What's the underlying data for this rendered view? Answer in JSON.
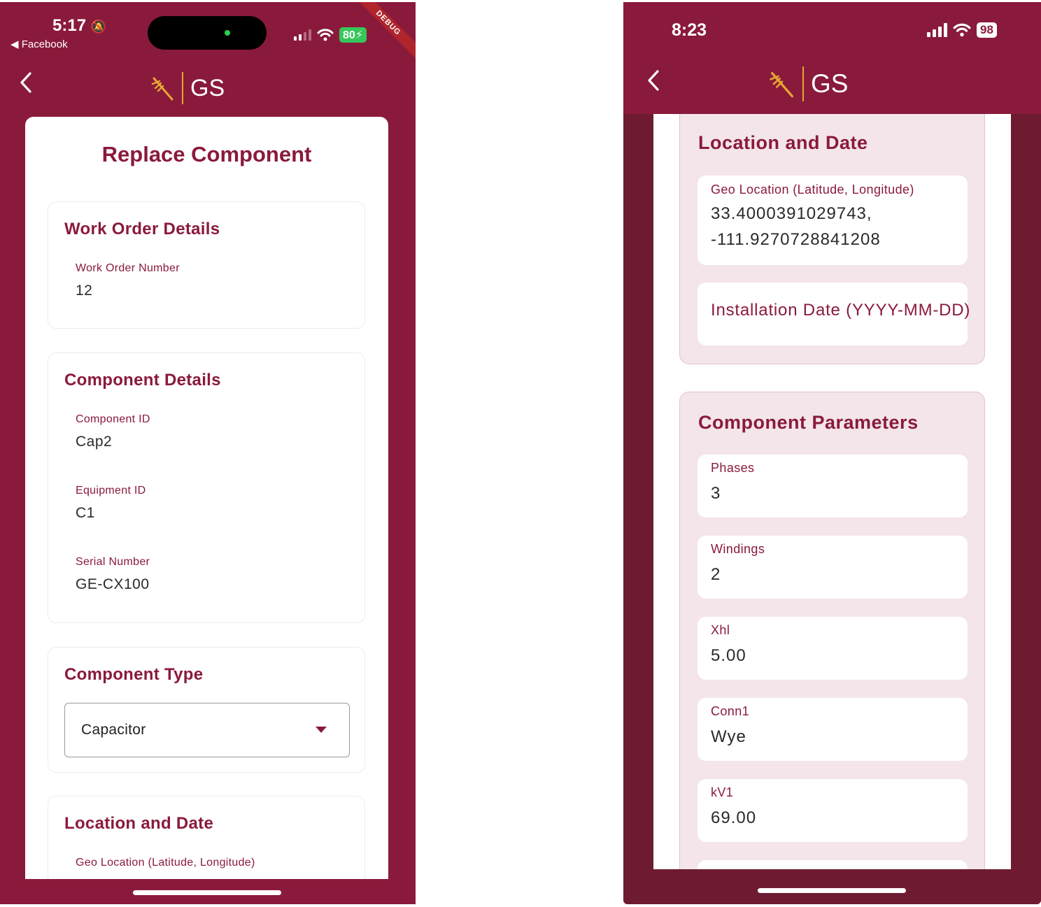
{
  "left_screen": {
    "status": {
      "time": "5:17",
      "back_app": "◀ Facebook",
      "battery": "80",
      "debug_label": "DEBUG"
    },
    "nav": {
      "back_glyph": "‹",
      "logo_text": "GS"
    },
    "page_title": "Replace Component",
    "work_order": {
      "title": "Work Order Details",
      "fields": [
        {
          "label": "Work Order Number",
          "value": "12"
        }
      ]
    },
    "component_details": {
      "title": "Component Details",
      "fields": [
        {
          "label": "Component ID",
          "value": "Cap2"
        },
        {
          "label": "Equipment ID",
          "value": "C1"
        },
        {
          "label": "Serial Number",
          "value": "GE-CX100"
        }
      ]
    },
    "component_type": {
      "title": "Component Type",
      "selected": "Capacitor"
    },
    "location": {
      "title": "Location and Date",
      "geo_label": "Geo Location (Latitude, Longitude)"
    }
  },
  "right_screen": {
    "status": {
      "time": "8:23",
      "battery": "98"
    },
    "nav": {
      "back_glyph": "‹",
      "logo_text": "GS"
    },
    "location": {
      "title": "Location and Date",
      "geo_label": "Geo Location (Latitude, Longitude)",
      "geo_value_line1": "33.4000391029743,",
      "geo_value_line2": "-111.9270728841208",
      "date_placeholder": "Installation Date (YYYY-MM-DD)"
    },
    "parameters": {
      "title": "Component Parameters",
      "fields": [
        {
          "label": "Phases",
          "value": "3"
        },
        {
          "label": "Windings",
          "value": "2"
        },
        {
          "label": "Xhl",
          "value": "5.00"
        },
        {
          "label": "Conn1",
          "value": "Wye"
        },
        {
          "label": "kV1",
          "value": "69.00"
        }
      ]
    }
  },
  "colors": {
    "brand": "#8a1a3b",
    "brand_dark": "#6e1b31",
    "logo_accent": "#e5a634",
    "section_tint": "#f3e5e9"
  }
}
